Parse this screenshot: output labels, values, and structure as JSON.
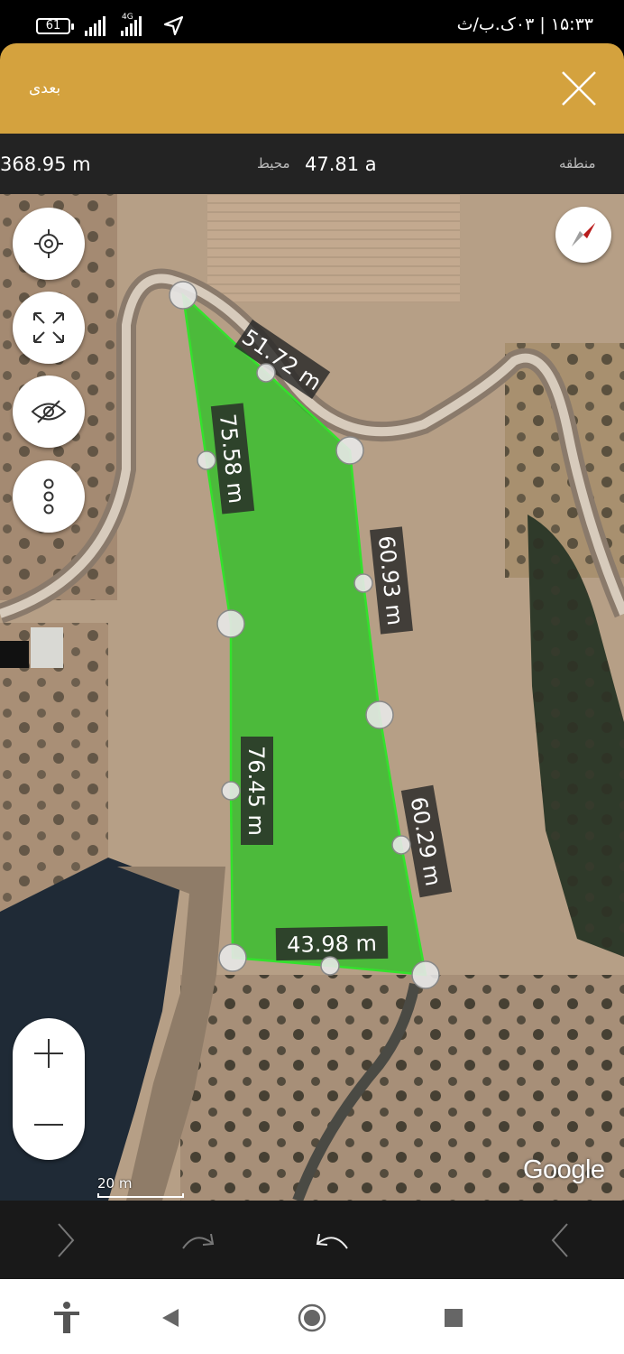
{
  "status_bar": {
    "battery": "61",
    "network": "4G",
    "time": "۱۵:۳۳ | ۰۳ک.ب/ث"
  },
  "top_bar": {
    "next_label": "بعدی",
    "close_icon": "close-icon"
  },
  "measurements": {
    "perimeter_value": "368.95 m",
    "perimeter_label": "محیط",
    "area_value": "47.81 a",
    "area_label": "منطقه"
  },
  "map": {
    "polygon_color": "#22c51e",
    "edges": [
      {
        "label": "51.72 m"
      },
      {
        "label": "75.58 m"
      },
      {
        "label": "60.93 m"
      },
      {
        "label": "76.45 m"
      },
      {
        "label": "60.29 m"
      },
      {
        "label": "43.98 m"
      }
    ],
    "scale_label": "20 m",
    "attribution": "Google"
  },
  "controls": {
    "locate_icon": "crosshair-icon",
    "fit_icon": "fit-bounds-icon",
    "visibility_icon": "eye-off-icon",
    "more_icon": "more-vertical-icon",
    "compass_icon": "compass-icon",
    "zoom_in": "+",
    "zoom_out": "−"
  },
  "bottom_actions": {
    "left": "chevron-right-icon",
    "redo": "redo-icon",
    "undo": "undo-icon",
    "right": "chevron-left-icon"
  },
  "colors": {
    "header": "#d4a23e",
    "info_bar": "#2b2b2b"
  }
}
